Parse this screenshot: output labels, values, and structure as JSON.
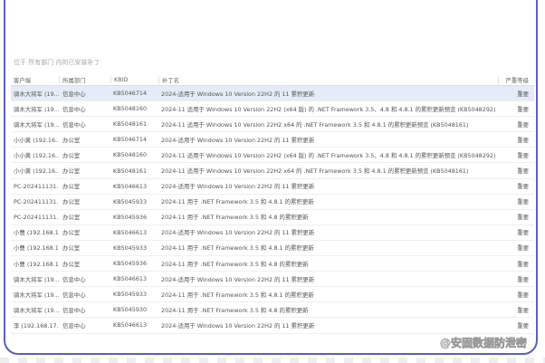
{
  "caption": "位于 所有部门 内的已安装补丁",
  "columns": [
    "客户端",
    "所属部门",
    "KBID",
    "补丁名",
    "严重等级"
  ],
  "rows": [
    [
      "骑木大将军 (19...",
      "信息中心",
      "KB5046714",
      "2024-适用于 Windows 10 Version 22H2 的 11 累积更新",
      "重要"
    ],
    [
      "骑木大将军 (19...",
      "信息中心",
      "KB5048160",
      "2024-11 适用于 Windows 10 Version 22H2 (x64 版) 的 .NET Framework 3.5、4.8 和 4.8.1 的累积更新预览 (KB5048292)",
      "重要"
    ],
    [
      "骑木大将军 (19...",
      "信息中心",
      "KB5048161",
      "2024-11 适用于 Windows 10 Version 22H2 x64 的 .NET Framework 3.5 和 4.8.1 的累积更新预览 (KB5048161)",
      "重要"
    ],
    [
      "小小黄 (192.16...",
      "办公室",
      "KB5046714",
      "2024-适用于 Windows 10 Version 22H2 的 11 累积更新",
      "重要"
    ],
    [
      "小小黄 (192.16...",
      "办公室",
      "KB5048160",
      "2024-11 适用于 Windows 10 Version 22H2 (x64 版) 的 .NET Framework 3.5、4.8 和 4.8.1 的累积更新预览 (KB5048292)",
      "重要"
    ],
    [
      "小小黄 (192.16...",
      "办公室",
      "KB5048161",
      "2024-11 适用于 Windows 10 Version 22H2 x64 的 .NET Framework 3.5 和 4.8.1 的累积更新预览 (KB5048161)",
      "重要"
    ],
    [
      "PC-202411131...",
      "办公室",
      "KB5046613",
      "2024-适用于 Windows 10 Version 22H2 的 11 累积更新",
      "重要"
    ],
    [
      "PC-202411131...",
      "办公室",
      "KB5045933",
      "2024-11 用于 .NET Framework 3.5 和 4.8.1 的累积更新",
      "重要"
    ],
    [
      "PC-202411131...",
      "办公室",
      "KB5045936",
      "2024-11 用于 .NET Framework 3.5 和 4.8 的累积更新",
      "重要"
    ],
    [
      "小曹 (192.168.1...",
      "办公室",
      "KB5046613",
      "2024-适用于 Windows 10 Version 22H2 的 11 累积更新",
      "重要"
    ],
    [
      "小曹 (192.168.1...",
      "办公室",
      "KB5045933",
      "2024-11 用于 .NET Framework 3.5 和 4.8.1 的累积更新",
      "重要"
    ],
    [
      "小曹 (192.168.1...",
      "办公室",
      "KB5045936",
      "2024-11 用于 .NET Framework 3.5 和 4.8 的累积更新",
      "重要"
    ],
    [
      "骑木大将军 (19...",
      "信息中心",
      "KB5046613",
      "2024-适用于 Windows 10 Version 22H2 的 11 累积更新",
      "重要"
    ],
    [
      "骑木大将军 (19...",
      "信息中心",
      "KB5045933",
      "2024-11 用于 .NET Framework 3.5 和 4.8.1 的累积更新",
      "重要"
    ],
    [
      "骑木大将军 (19...",
      "信息中心",
      "KB5045930",
      "2024-11 用于 .NET Framework 3.5 和 4.8 的累积更新",
      "重要"
    ],
    [
      "李 (192.168.17...",
      "信息中心",
      "KB5046613",
      "2024-适用于 Windows 10 Version 22H2 的 11 累积更新",
      "重要"
    ]
  ],
  "watermark": "@安固数据防泄密",
  "colors": {
    "frame": "#5a60b8",
    "selected_row": "#e4ecf7"
  }
}
